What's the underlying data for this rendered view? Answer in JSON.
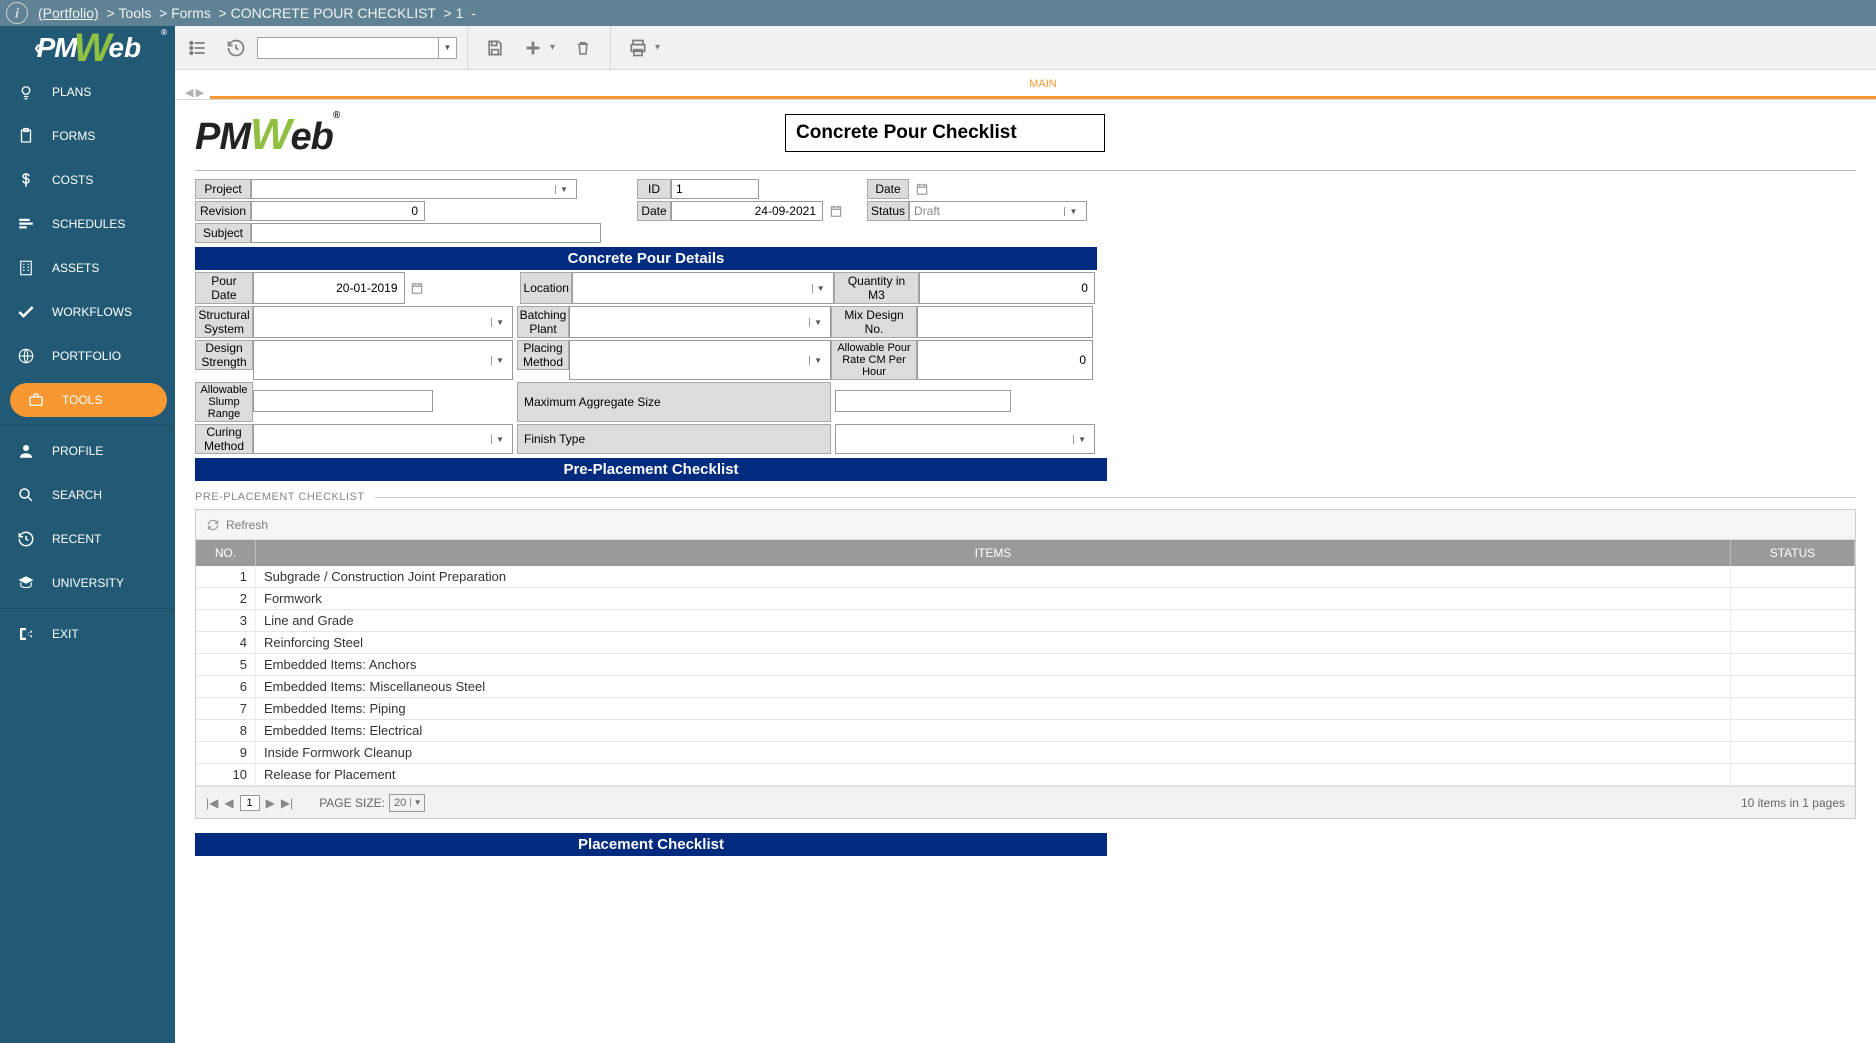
{
  "breadcrumb": {
    "portfolio": "(Portfolio)",
    "l1": "Tools",
    "l2": "Forms",
    "l3": "CONCRETE POUR CHECKLIST",
    "l4": "1",
    "l5": "-"
  },
  "sidebar": {
    "items": [
      {
        "label": "PLANS"
      },
      {
        "label": "FORMS"
      },
      {
        "label": "COSTS"
      },
      {
        "label": "SCHEDULES"
      },
      {
        "label": "ASSETS"
      },
      {
        "label": "WORKFLOWS"
      },
      {
        "label": "PORTFOLIO"
      },
      {
        "label": "TOOLS"
      },
      {
        "label": "PROFILE"
      },
      {
        "label": "SEARCH"
      },
      {
        "label": "RECENT"
      },
      {
        "label": "UNIVERSITY"
      },
      {
        "label": "EXIT"
      }
    ]
  },
  "tabs": {
    "main": "MAIN"
  },
  "form": {
    "title": "Concrete Pour Checklist",
    "labels": {
      "project": "Project",
      "id": "ID",
      "date": "Date",
      "revision": "Revision",
      "date2": "Date",
      "status": "Status",
      "subject": "Subject",
      "pour_date": "Pour Date",
      "location": "Location",
      "quantity": "Quantity in M3",
      "structural_system": "Structural System",
      "batching_plant": "Batching Plant",
      "mix_design": "Mix Design No.",
      "design_strength": "Design Strength",
      "placing_method": "Placing Method",
      "allowable_rate": "Allowable Pour Rate CM Per Hour",
      "slump_range": "Allowable Slump Range",
      "max_agg": "Maximum Aggregate Size",
      "curing_method": "Curing Method",
      "finish_type": "Finish Type"
    },
    "values": {
      "project": "",
      "id": "1",
      "date": "",
      "revision": "0",
      "date2": "24-09-2021",
      "status": "Draft",
      "subject": "",
      "pour_date": "20-01-2019",
      "location": "",
      "quantity": "0",
      "structural_system": "",
      "batching_plant": "",
      "mix_design": "",
      "design_strength": "",
      "placing_method": "",
      "allowable_rate": "0",
      "slump_range": "",
      "max_agg": "",
      "curing_method": "",
      "finish_type": ""
    },
    "sections": {
      "details": "Concrete Pour Details",
      "preplacement": "Pre-Placement Checklist",
      "placement": "Placement Checklist"
    }
  },
  "group": {
    "preplacement": "PRE-PLACEMENT CHECKLIST"
  },
  "grid": {
    "refresh": "Refresh",
    "headers": {
      "no": "NO.",
      "items": "ITEMS",
      "status": "STATUS"
    },
    "rows": [
      {
        "no": "1",
        "item": "Subgrade / Construction Joint Preparation"
      },
      {
        "no": "2",
        "item": "Formwork"
      },
      {
        "no": "3",
        "item": "Line and Grade"
      },
      {
        "no": "4",
        "item": "Reinforcing Steel"
      },
      {
        "no": "5",
        "item": "Embedded Items: Anchors"
      },
      {
        "no": "6",
        "item": "Embedded Items: Miscellaneous Steel"
      },
      {
        "no": "7",
        "item": "Embedded Items: Piping"
      },
      {
        "no": "8",
        "item": "Embedded Items: Electrical"
      },
      {
        "no": "9",
        "item": "Inside Formwork Cleanup"
      },
      {
        "no": "10",
        "item": "Release for Placement"
      }
    ],
    "footer": {
      "page": "1",
      "page_size_label": "PAGE SIZE:",
      "page_size": "20",
      "summary": "10 items in 1 pages"
    }
  }
}
